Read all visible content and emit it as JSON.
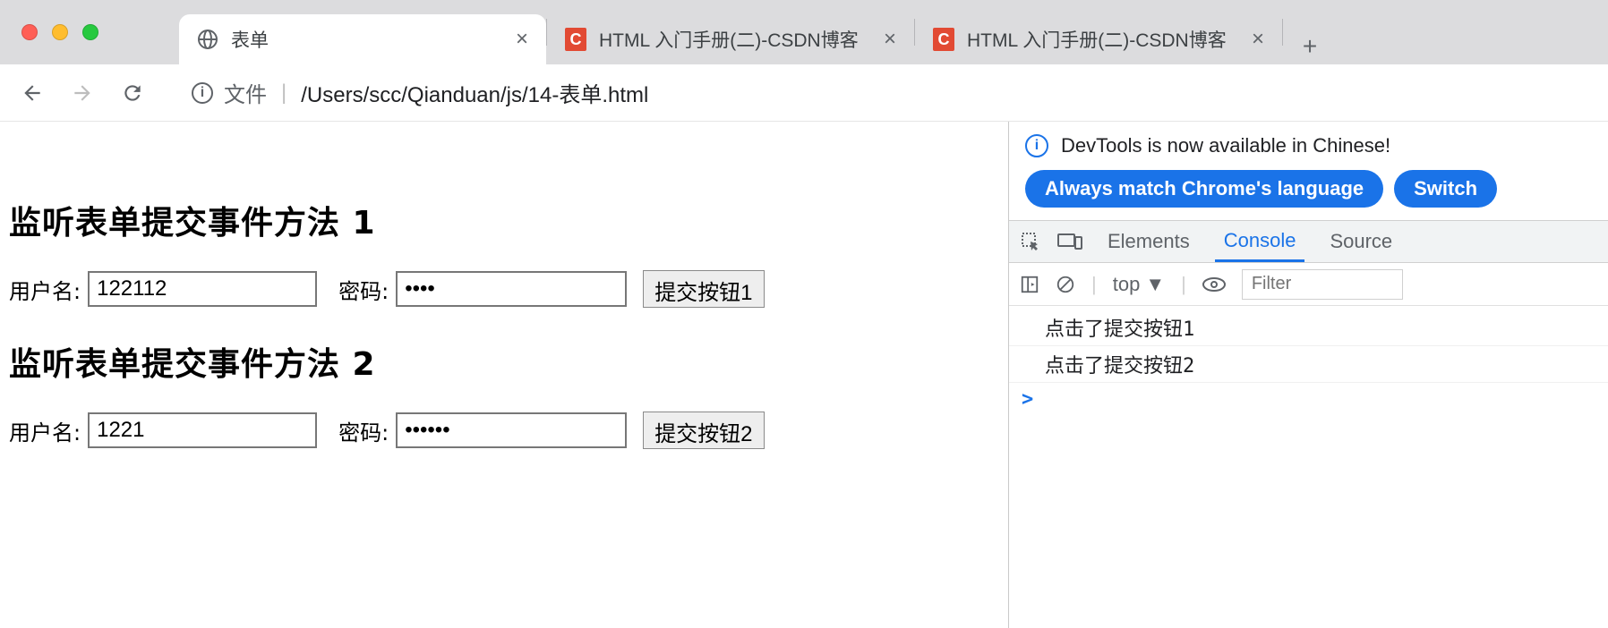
{
  "browser": {
    "tabs": [
      {
        "title": "表单",
        "favicon": "globe"
      },
      {
        "title": "HTML 入门手册(二)-CSDN博客",
        "favicon": "csdn"
      },
      {
        "title": "HTML 入门手册(二)-CSDN博客",
        "favicon": "csdn"
      }
    ],
    "address": {
      "scheme_label": "文件",
      "path": "/Users/scc/Qianduan/js/14-表单.html"
    }
  },
  "page": {
    "heading1": "监听表单提交事件方法 1",
    "heading2": "监听表单提交事件方法 2",
    "form1": {
      "username_label": "用户名:",
      "username_value": "122112",
      "password_label": "密码:",
      "password_value": "••••",
      "submit_label": "提交按钮1"
    },
    "form2": {
      "username_label": "用户名:",
      "username_value": "1221",
      "password_label": "密码:",
      "password_value": "••••••",
      "submit_label": "提交按钮2"
    }
  },
  "devtools": {
    "info_text": "DevTools is now available in Chinese!",
    "button_always": "Always match Chrome's language",
    "button_switch": "Switch",
    "tabs": {
      "elements": "Elements",
      "console": "Console",
      "sources": "Source"
    },
    "toolbar": {
      "context": "top",
      "filter_placeholder": "Filter"
    },
    "logs": [
      "点击了提交按钮1",
      "点击了提交按钮2"
    ],
    "prompt": ">"
  }
}
